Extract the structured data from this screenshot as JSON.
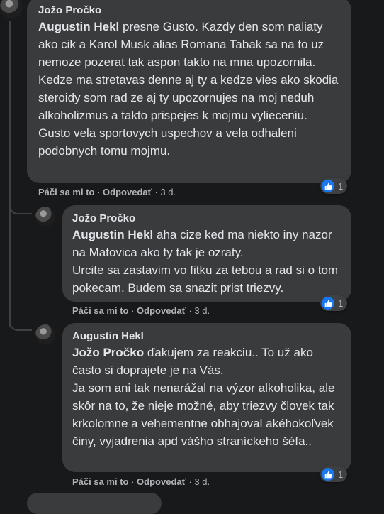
{
  "comments": [
    {
      "author": "Jožo Pročko",
      "mention": "Augustin Hekl",
      "text": " presne Gusto. Kazdy den som naliaty ako cik a Karol Musk alias Romana Tabak sa na to uz nemoze pozerat tak aspon takto na mna upozornila. Kedze ma stretavas denne aj ty a kedze vies ako skodia steroidy som rad ze aj ty upozornujes na moj neduh alkoholizmus a takto prispejes k mojmu vylieceniu.\nGusto vela sportovych uspechov a vela odhaleni podobnych tomu mojmu.",
      "like": "Páči sa mi to",
      "reply": "Odpovedať",
      "time": "3 d.",
      "reactions": "1"
    },
    {
      "author": "Jožo Pročko",
      "mention": "Augustin Hekl",
      "text": " aha cize ked ma niekto iny nazor na Matovica ako ty tak je ozraty.\nUrcite sa zastavim vo fitku za tebou a rad si o tom pokecam. Budem sa snazit prist triezvy.",
      "like": "Páči sa mi to",
      "reply": "Odpovedať",
      "time": "3 d.",
      "reactions": "1"
    },
    {
      "author": "Augustin Hekl",
      "mention": "Jožo Pročko",
      "text": " ďakujem za reakciu.. To už ako často si doprajete je na Vás.\nJa som ani tak nenarážal na výzor alkoholika, ale skôr na to, že nieje možné, aby triezvy človek tak krkolomne a vehementne obhajoval akéhokoľvek činy, vyjadrenia apd vášho straníckeho šéfa..",
      "like": "Páči sa mi to",
      "reply": "Odpovedať",
      "time": "3 d.",
      "reactions": "1"
    }
  ],
  "separator": " · ",
  "colors": {
    "background": "#18191a",
    "bubble": "#3a3b3c",
    "like_blue": "#1877f2"
  },
  "icons": {
    "like": "thumbs-up-icon"
  }
}
